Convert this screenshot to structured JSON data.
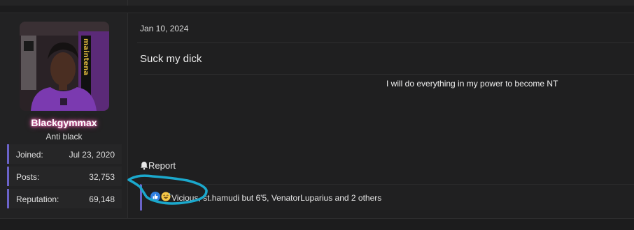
{
  "user": {
    "username": "Blackgymmax",
    "title": "Anti black",
    "avatar_description": "profile photo of user in purple shirt",
    "stats": [
      {
        "label": "Joined:",
        "value": "Jul 23, 2020"
      },
      {
        "label": "Posts:",
        "value": "32,753"
      },
      {
        "label": "Reputation:",
        "value": "69,148"
      }
    ]
  },
  "post": {
    "date": "Jan 10, 2024",
    "message": "Suck my dick",
    "signature": "I will do everything in my power to become NT"
  },
  "actions": {
    "report_label": "Report",
    "report_icon": "bell-icon"
  },
  "reactions": {
    "icons": [
      "like-icon",
      "grin-sweat-icon"
    ],
    "text": "Vicious, st.hamudi but 6'5, VenatorLuparius and 2 others"
  },
  "colors": {
    "accent": "#6b63c9",
    "username_glow": "#e25ea8",
    "annotation": "#1ba8cc",
    "like_blue": "#2f7fe0"
  }
}
